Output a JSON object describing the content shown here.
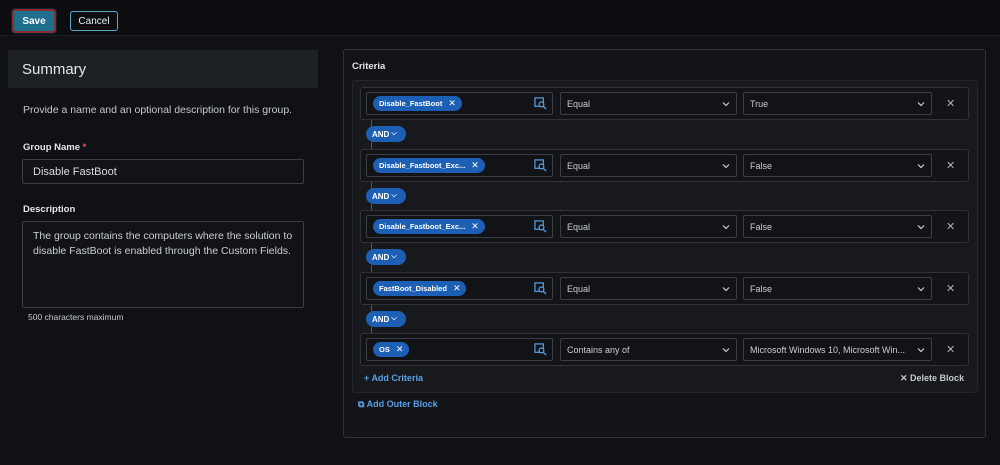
{
  "toolbar": {
    "save_label": "Save",
    "cancel_label": "Cancel"
  },
  "summary": {
    "title": "Summary",
    "description": "Provide a name and an optional description for this group.",
    "group_name_label": "Group Name",
    "required_mark": "*",
    "group_name_value": "Disable FastBoot",
    "description_label": "Description",
    "description_value": "The group contains the computers where the solution to disable FastBoot is enabled through the Custom Fields.",
    "max_chars": "500 characters maximum"
  },
  "criteria": {
    "title": "Criteria",
    "rows": [
      {
        "field": "Disable_FastBoot",
        "operator": "Equal",
        "value": "True"
      },
      {
        "field": "Disable_Fastboot_Exc...",
        "operator": "Equal",
        "value": "False"
      },
      {
        "field": "Disable_Fastboot_Exc...",
        "operator": "Equal",
        "value": "False"
      },
      {
        "field": "FastBoot_Disabled",
        "operator": "Equal",
        "value": "False"
      },
      {
        "field": "OS",
        "operator": "Contains any of",
        "value": "Microsoft Windows 10, Microsoft Win..."
      }
    ],
    "and_label": "AND",
    "add_criteria": "Add Criteria",
    "delete_block": "Delete Block",
    "add_outer_block": "Add Outer Block"
  },
  "colors": {
    "accent": "#1d5fb4",
    "link": "#5aa0e6",
    "save_bg": "#1f6e8e"
  },
  "icons": {
    "remove": "close-icon",
    "field_search": "field-search-icon",
    "dropdown": "chevron-down-icon"
  }
}
